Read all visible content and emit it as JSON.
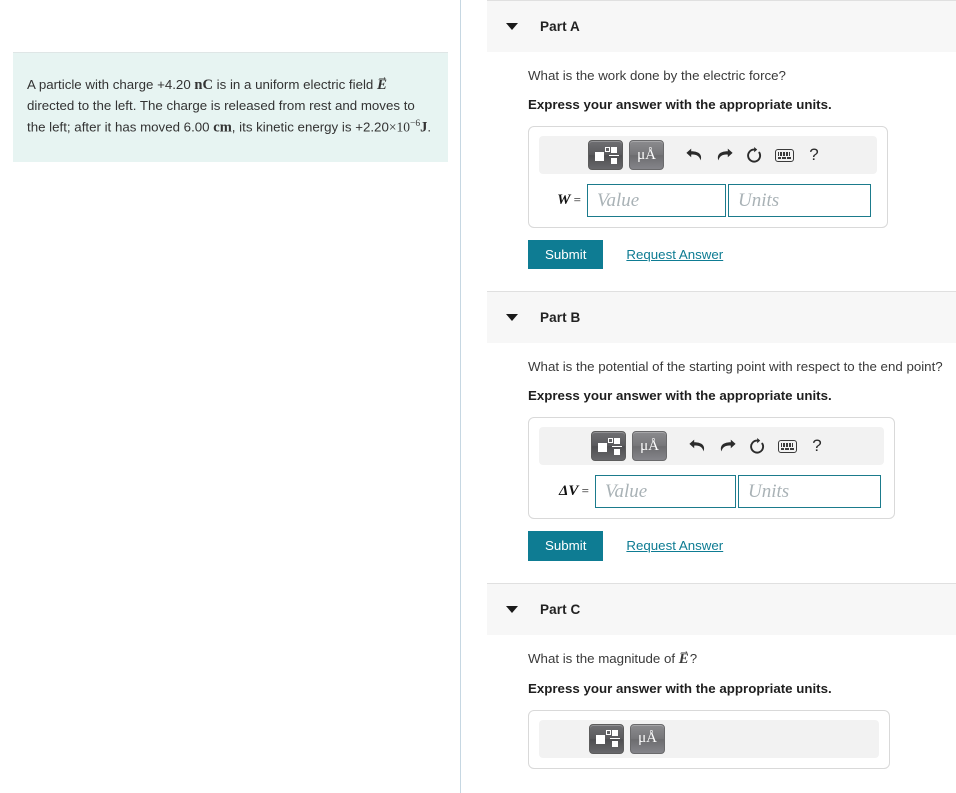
{
  "problem": {
    "text_before_charge": "A particle with charge +4.20 ",
    "charge_unit": "nC",
    "text_after_charge": " is in a uniform electric field ",
    "field_symbol": "E",
    "text_after_field": " directed to the left. The charge is released from rest and moves to the left; after it has moved 6.00 ",
    "distance_unit": "cm",
    "text_after_distance": ", its kinetic energy is +2.20",
    "times_symbol": "×",
    "power_base": "10",
    "power_exponent": "−6",
    "energy_unit": "J",
    "text_end": "."
  },
  "toolbar_icons": {
    "template_label": "template-button",
    "units_label": "μÅ",
    "undo_label": "undo",
    "redo_label": "redo",
    "reset_label": "reset",
    "keyboard_label": "keyboard",
    "help_label": "?"
  },
  "fields": {
    "value_placeholder": "Value",
    "units_placeholder": "Units",
    "value_current": "",
    "units_current": ""
  },
  "actions": {
    "submit_label": "Submit",
    "request_answer_label": "Request Answer"
  },
  "colors": {
    "accent_teal": "#0e7c93",
    "problem_bg": "#e7f4f2",
    "header_bg": "#f7f7f7",
    "field_border": "#1b7b8c"
  },
  "parts": [
    {
      "title": "Part A",
      "question": "What is the work done by the electric force?",
      "express": "Express your answer with the appropriate units.",
      "answer_symbol": "W",
      "answer_equals": " ="
    },
    {
      "title": "Part B",
      "question": "What is the potential of the starting point with respect to the end point?",
      "express": "Express your answer with the appropriate units.",
      "answer_symbol": "ΔV",
      "answer_equals": " ="
    },
    {
      "title": "Part C",
      "question_prefix": "What is the magnitude of ",
      "question_symbol": "E",
      "question_suffix": "?",
      "express": "Express your answer with the appropriate units."
    }
  ]
}
